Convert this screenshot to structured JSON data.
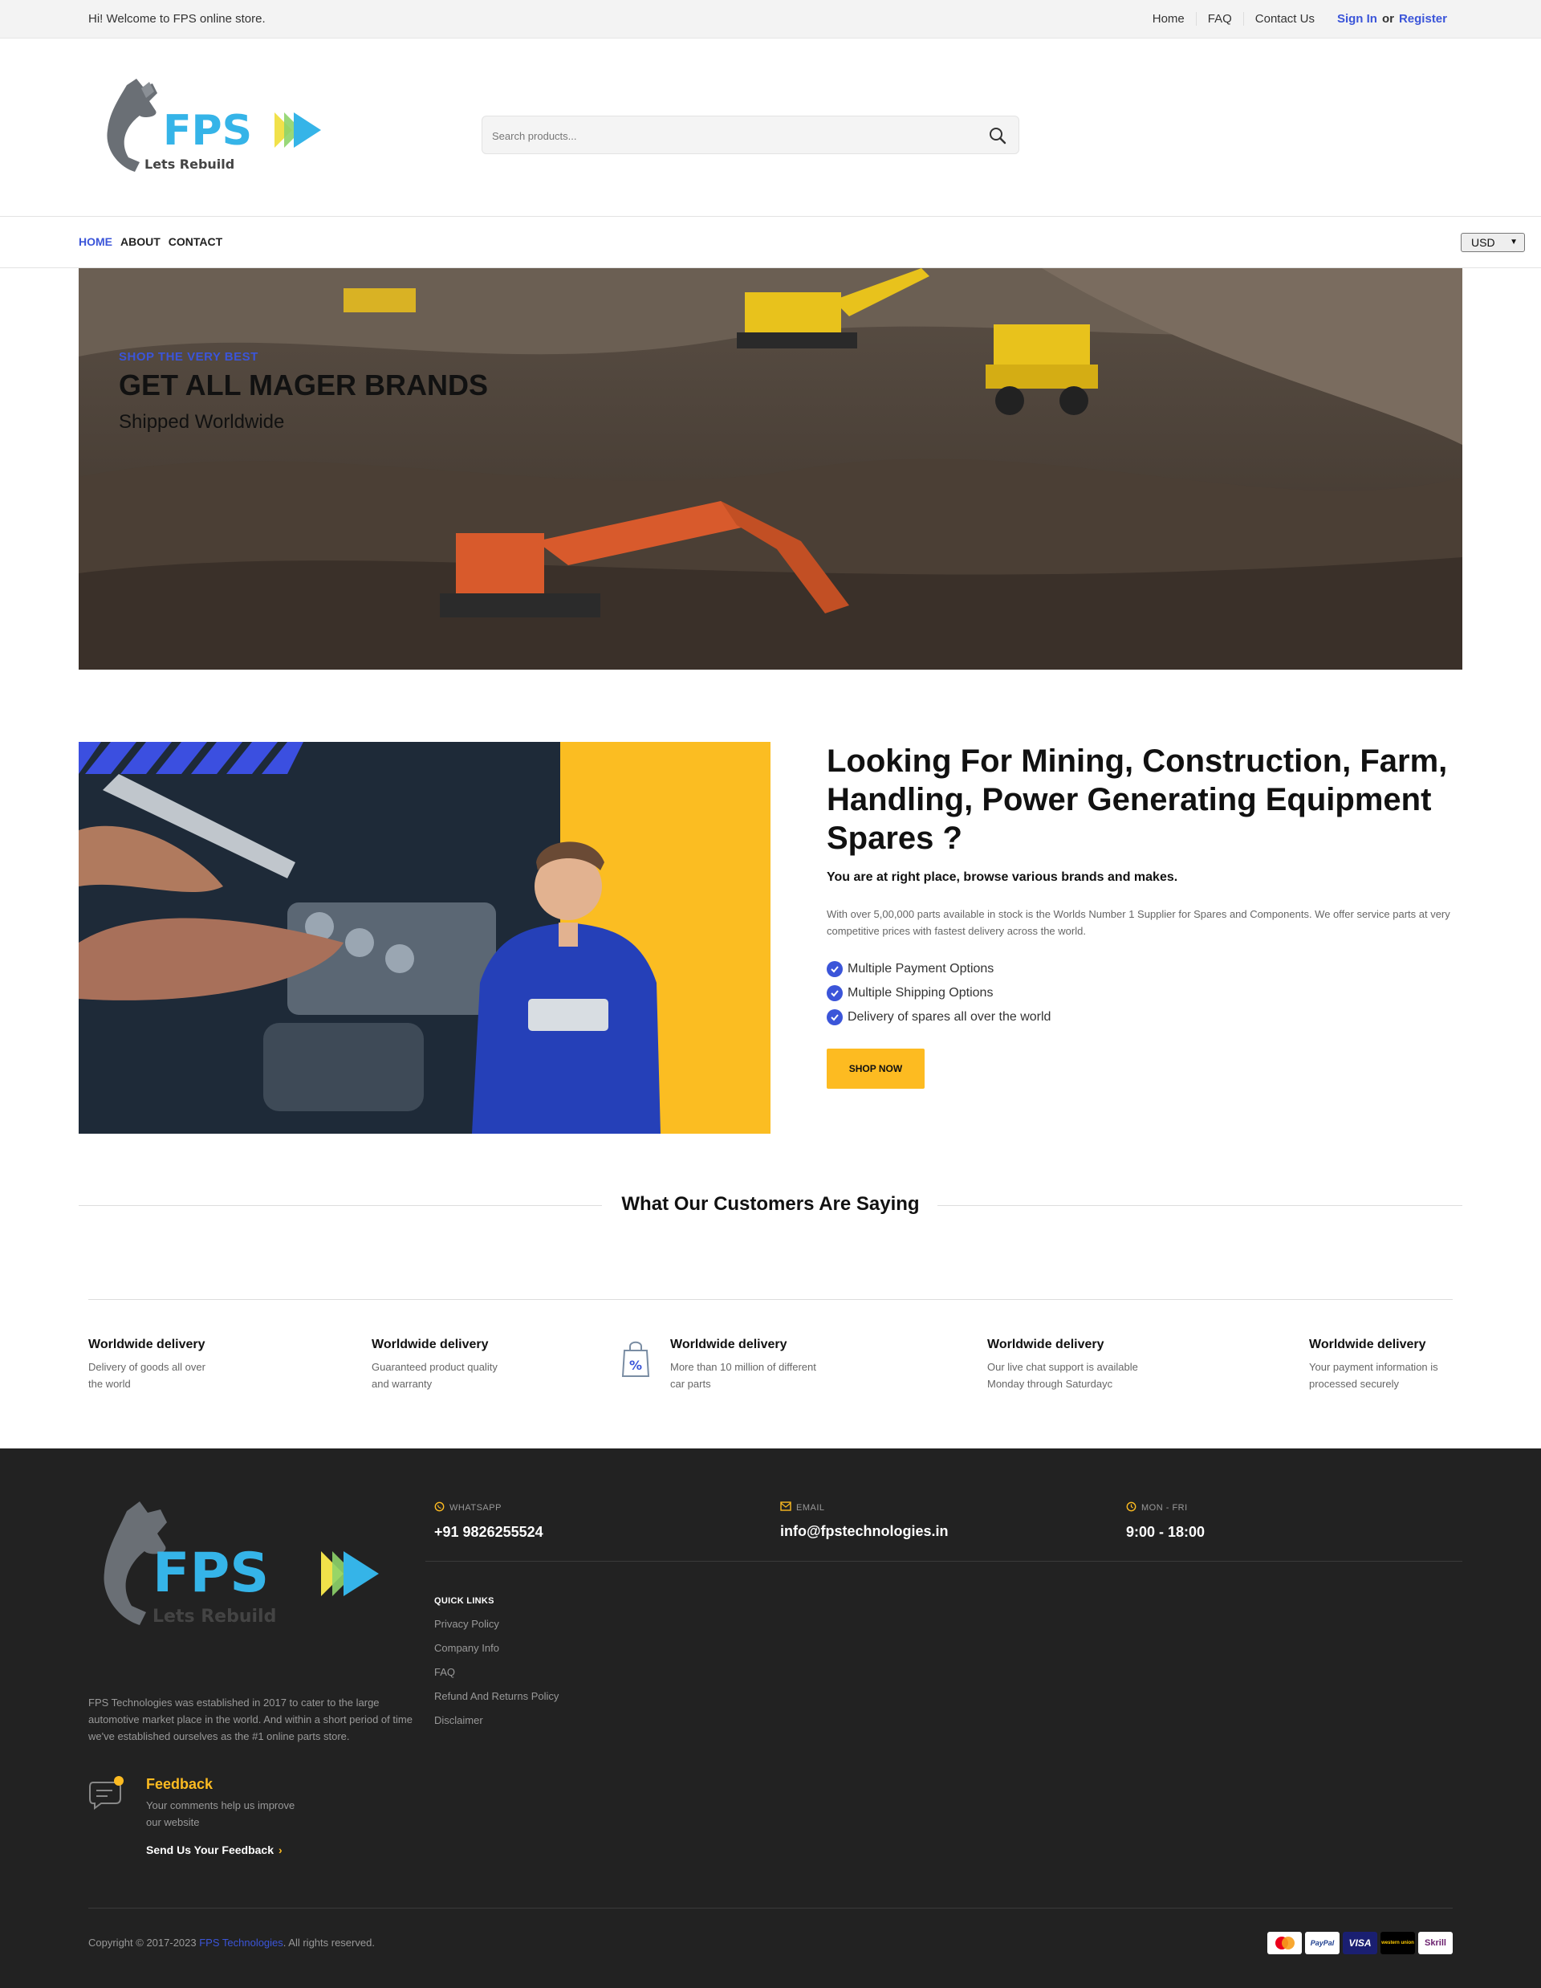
{
  "topbar": {
    "welcome": "Hi! Welcome to FPS online store.",
    "links": [
      "Home",
      "FAQ",
      "Contact Us"
    ],
    "sign_in": "Sign In",
    "or": "or",
    "register": "Register"
  },
  "header": {
    "logo_text": "FPS",
    "logo_tagline": "Lets Rebuild",
    "search_placeholder": "Search products..."
  },
  "nav": {
    "items": [
      "HOME",
      "ABOUT",
      "CONTACT"
    ],
    "currency": "USD"
  },
  "hero": {
    "kicker": "SHOP THE VERY BEST",
    "title": "GET ALL MAGER BRANDS",
    "subtitle": "Shipped Worldwide"
  },
  "promo": {
    "heading": "Looking For Mining, Construction, Farm, Handling, Power Generating Equipment Spares ?",
    "lead": "You are at right place, browse various brands and makes.",
    "description": "With over 5,00,000 parts available in stock is the Worlds Number 1 Supplier for Spares and Components. We offer service parts at very competitive prices with fastest delivery across the world.",
    "bullets": [
      "Multiple Payment Options",
      "Multiple Shipping Options",
      "Delivery of spares all over the world"
    ],
    "button": "SHOP NOW"
  },
  "testimonials": {
    "heading": "What Our Customers Are Saying"
  },
  "features": [
    {
      "title": "Worldwide delivery",
      "line1": "Delivery of goods all over",
      "line2": "the world"
    },
    {
      "title": "Worldwide delivery",
      "line1": "Guaranteed product quality",
      "line2": "and warranty"
    },
    {
      "title": "Worldwide delivery",
      "line1": "More than 10 million of different",
      "line2": "car parts"
    },
    {
      "title": "Worldwide delivery",
      "line1": "Our live chat support is available",
      "line2": "Monday through Saturdayc"
    },
    {
      "title": "Worldwide delivery",
      "line1": "Your payment information is",
      "line2": "processed securely"
    }
  ],
  "footer": {
    "about": "FPS Technologies was established in 2017 to cater to the large automotive market place in the world. And within a short period of time we've established ourselves as the #1 online parts store.",
    "feedback_title": "Feedback",
    "feedback_desc": "Your comments help us improve our website",
    "feedback_link": "Send Us Your Feedback",
    "contacts": [
      {
        "label": "WHATSAPP",
        "value": "+91 9826255524",
        "icon": "whatsapp-icon"
      },
      {
        "label": "EMAIL",
        "value": "info@fpstechnologies.in",
        "icon": "mail-icon"
      },
      {
        "label": "MON - FRI",
        "value": "9:00 - 18:00",
        "icon": "clock-icon"
      }
    ],
    "quick_links_heading": "QUICK LINKS",
    "quick_links": [
      "Privacy Policy",
      "Company Info",
      "FAQ",
      "Refund And Returns Policy",
      "Disclaimer"
    ],
    "copyright_prefix": "Copyright © 2017-2023",
    "copyright_brand": "FPS Technologies",
    "copyright_suffix": ". All rights reserved.",
    "payments": [
      "mastercard",
      "PayPal",
      "VISA",
      "western union",
      "Skrill"
    ]
  },
  "colors": {
    "accent_blue": "#3b55d9",
    "accent_yellow": "#fdbb21",
    "footer_bg": "#222222",
    "logo_cyan": "#35b4e8"
  }
}
